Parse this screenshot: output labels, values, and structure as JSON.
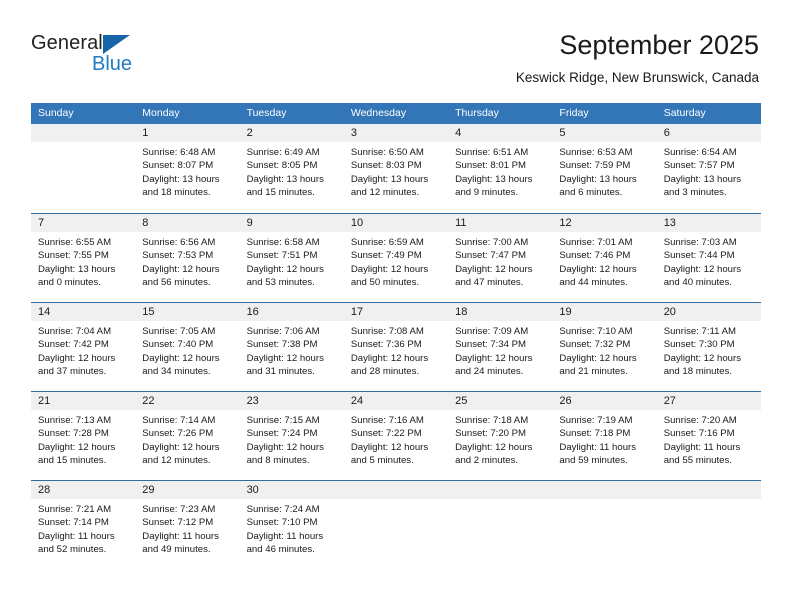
{
  "logo": {
    "word_top": "General",
    "word_bottom": "Blue",
    "triangle_color": "#1565a8",
    "blue_color": "#1f7bc4"
  },
  "header": {
    "title": "September 2025",
    "subtitle": "Keswick Ridge, New Brunswick, Canada"
  },
  "theme": {
    "header_blue": "#3276b8",
    "day_band_gray": "#f0f0f0",
    "grid_line": "#2e6da4"
  },
  "weekdays": [
    "Sunday",
    "Monday",
    "Tuesday",
    "Wednesday",
    "Thursday",
    "Friday",
    "Saturday"
  ],
  "weeks": [
    [
      {
        "day": "",
        "lines": []
      },
      {
        "day": "1",
        "lines": [
          "Sunrise: 6:48 AM",
          "Sunset: 8:07 PM",
          "Daylight: 13 hours",
          "and 18 minutes."
        ]
      },
      {
        "day": "2",
        "lines": [
          "Sunrise: 6:49 AM",
          "Sunset: 8:05 PM",
          "Daylight: 13 hours",
          "and 15 minutes."
        ]
      },
      {
        "day": "3",
        "lines": [
          "Sunrise: 6:50 AM",
          "Sunset: 8:03 PM",
          "Daylight: 13 hours",
          "and 12 minutes."
        ]
      },
      {
        "day": "4",
        "lines": [
          "Sunrise: 6:51 AM",
          "Sunset: 8:01 PM",
          "Daylight: 13 hours",
          "and 9 minutes."
        ]
      },
      {
        "day": "5",
        "lines": [
          "Sunrise: 6:53 AM",
          "Sunset: 7:59 PM",
          "Daylight: 13 hours",
          "and 6 minutes."
        ]
      },
      {
        "day": "6",
        "lines": [
          "Sunrise: 6:54 AM",
          "Sunset: 7:57 PM",
          "Daylight: 13 hours",
          "and 3 minutes."
        ]
      }
    ],
    [
      {
        "day": "7",
        "lines": [
          "Sunrise: 6:55 AM",
          "Sunset: 7:55 PM",
          "Daylight: 13 hours",
          "and 0 minutes."
        ]
      },
      {
        "day": "8",
        "lines": [
          "Sunrise: 6:56 AM",
          "Sunset: 7:53 PM",
          "Daylight: 12 hours",
          "and 56 minutes."
        ]
      },
      {
        "day": "9",
        "lines": [
          "Sunrise: 6:58 AM",
          "Sunset: 7:51 PM",
          "Daylight: 12 hours",
          "and 53 minutes."
        ]
      },
      {
        "day": "10",
        "lines": [
          "Sunrise: 6:59 AM",
          "Sunset: 7:49 PM",
          "Daylight: 12 hours",
          "and 50 minutes."
        ]
      },
      {
        "day": "11",
        "lines": [
          "Sunrise: 7:00 AM",
          "Sunset: 7:47 PM",
          "Daylight: 12 hours",
          "and 47 minutes."
        ]
      },
      {
        "day": "12",
        "lines": [
          "Sunrise: 7:01 AM",
          "Sunset: 7:46 PM",
          "Daylight: 12 hours",
          "and 44 minutes."
        ]
      },
      {
        "day": "13",
        "lines": [
          "Sunrise: 7:03 AM",
          "Sunset: 7:44 PM",
          "Daylight: 12 hours",
          "and 40 minutes."
        ]
      }
    ],
    [
      {
        "day": "14",
        "lines": [
          "Sunrise: 7:04 AM",
          "Sunset: 7:42 PM",
          "Daylight: 12 hours",
          "and 37 minutes."
        ]
      },
      {
        "day": "15",
        "lines": [
          "Sunrise: 7:05 AM",
          "Sunset: 7:40 PM",
          "Daylight: 12 hours",
          "and 34 minutes."
        ]
      },
      {
        "day": "16",
        "lines": [
          "Sunrise: 7:06 AM",
          "Sunset: 7:38 PM",
          "Daylight: 12 hours",
          "and 31 minutes."
        ]
      },
      {
        "day": "17",
        "lines": [
          "Sunrise: 7:08 AM",
          "Sunset: 7:36 PM",
          "Daylight: 12 hours",
          "and 28 minutes."
        ]
      },
      {
        "day": "18",
        "lines": [
          "Sunrise: 7:09 AM",
          "Sunset: 7:34 PM",
          "Daylight: 12 hours",
          "and 24 minutes."
        ]
      },
      {
        "day": "19",
        "lines": [
          "Sunrise: 7:10 AM",
          "Sunset: 7:32 PM",
          "Daylight: 12 hours",
          "and 21 minutes."
        ]
      },
      {
        "day": "20",
        "lines": [
          "Sunrise: 7:11 AM",
          "Sunset: 7:30 PM",
          "Daylight: 12 hours",
          "and 18 minutes."
        ]
      }
    ],
    [
      {
        "day": "21",
        "lines": [
          "Sunrise: 7:13 AM",
          "Sunset: 7:28 PM",
          "Daylight: 12 hours",
          "and 15 minutes."
        ]
      },
      {
        "day": "22",
        "lines": [
          "Sunrise: 7:14 AM",
          "Sunset: 7:26 PM",
          "Daylight: 12 hours",
          "and 12 minutes."
        ]
      },
      {
        "day": "23",
        "lines": [
          "Sunrise: 7:15 AM",
          "Sunset: 7:24 PM",
          "Daylight: 12 hours",
          "and 8 minutes."
        ]
      },
      {
        "day": "24",
        "lines": [
          "Sunrise: 7:16 AM",
          "Sunset: 7:22 PM",
          "Daylight: 12 hours",
          "and 5 minutes."
        ]
      },
      {
        "day": "25",
        "lines": [
          "Sunrise: 7:18 AM",
          "Sunset: 7:20 PM",
          "Daylight: 12 hours",
          "and 2 minutes."
        ]
      },
      {
        "day": "26",
        "lines": [
          "Sunrise: 7:19 AM",
          "Sunset: 7:18 PM",
          "Daylight: 11 hours",
          "and 59 minutes."
        ]
      },
      {
        "day": "27",
        "lines": [
          "Sunrise: 7:20 AM",
          "Sunset: 7:16 PM",
          "Daylight: 11 hours",
          "and 55 minutes."
        ]
      }
    ],
    [
      {
        "day": "28",
        "lines": [
          "Sunrise: 7:21 AM",
          "Sunset: 7:14 PM",
          "Daylight: 11 hours",
          "and 52 minutes."
        ]
      },
      {
        "day": "29",
        "lines": [
          "Sunrise: 7:23 AM",
          "Sunset: 7:12 PM",
          "Daylight: 11 hours",
          "and 49 minutes."
        ]
      },
      {
        "day": "30",
        "lines": [
          "Sunrise: 7:24 AM",
          "Sunset: 7:10 PM",
          "Daylight: 11 hours",
          "and 46 minutes."
        ]
      },
      {
        "day": "",
        "lines": []
      },
      {
        "day": "",
        "lines": []
      },
      {
        "day": "",
        "lines": []
      },
      {
        "day": "",
        "lines": []
      }
    ]
  ]
}
